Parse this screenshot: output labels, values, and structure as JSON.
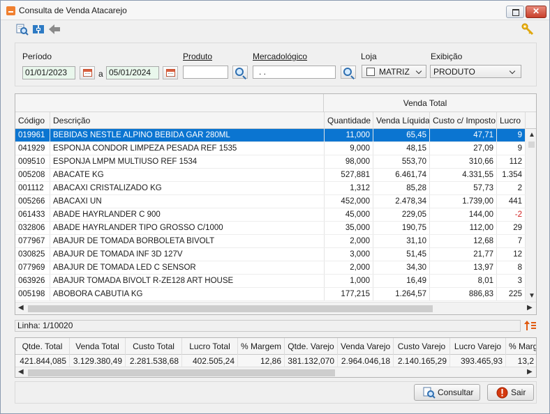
{
  "window": {
    "title": "Consulta de Venda Atacarejo",
    "close_glyph": "✕"
  },
  "toolbar": {
    "icons": [
      "search-icon",
      "export-icon",
      "back-arrow-icon",
      "key-icon"
    ]
  },
  "filters": {
    "periodo_label": "Período",
    "date_start": "01/01/2023",
    "date_sep": "a",
    "date_end": "05/01/2024",
    "produto_label": "Produto",
    "produto_value": "",
    "mercadologico_label": "Mercadológico",
    "mercadologico_value": ". .",
    "loja_label": "Loja",
    "loja_value": "MATRIZ",
    "exibicao_label": "Exibição",
    "exibicao_value": "PRODUTO"
  },
  "grid": {
    "group_header": "Venda Total",
    "columns": [
      "Código",
      "Descrição",
      "Quantidade",
      "Venda Líquida",
      "Custo c/ Imposto",
      "Lucro"
    ],
    "rows": [
      [
        "019961",
        "BEBIDAS NESTLE ALPINO BEBIDA GAR 280ML",
        "11,000",
        "65,45",
        "47,71",
        "9"
      ],
      [
        "041929",
        "ESPONJA CONDOR LIMPEZA PESADA REF 1535",
        "9,000",
        "48,15",
        "27,09",
        "9"
      ],
      [
        "009510",
        "ESPONJA LMPM MULTIUSO REF 1534",
        "98,000",
        "553,70",
        "310,66",
        "112"
      ],
      [
        "005208",
        "ABACATE KG",
        "527,881",
        "6.461,74",
        "4.331,55",
        "1.354"
      ],
      [
        "001112",
        "ABACAXI CRISTALIZADO KG",
        "1,312",
        "85,28",
        "57,73",
        "2"
      ],
      [
        "005266",
        "ABACAXI UN",
        "452,000",
        "2.478,34",
        "1.739,00",
        "441"
      ],
      [
        "061433",
        "ABADE HAYRLANDER C 900",
        "45,000",
        "229,05",
        "144,00",
        "-2"
      ],
      [
        "032806",
        "ABADE HAYRLANDER TIPO GROSSO C/1000",
        "35,000",
        "190,75",
        "112,00",
        "29"
      ],
      [
        "077967",
        "ABAJUR DE TOMADA BORBOLETA BIVOLT",
        "2,000",
        "31,10",
        "12,68",
        "7"
      ],
      [
        "030825",
        "ABAJUR DE TOMADA INF 3D 127V",
        "3,000",
        "51,45",
        "21,77",
        "12"
      ],
      [
        "077969",
        "ABAJUR DE TOMADA LED C SENSOR",
        "2,000",
        "34,30",
        "13,97",
        "8"
      ],
      [
        "063926",
        "ABAJUR TOMADA BIVOLT R-ZE128 ART HOUSE",
        "1,000",
        "16,49",
        "8,01",
        "3"
      ],
      [
        "005198",
        "ABOBORA CABUTIA KG",
        "177,215",
        "1.264,57",
        "886,83",
        "225"
      ]
    ]
  },
  "status": {
    "linha": "Linha: 1/10020"
  },
  "totals": {
    "columns": [
      "Qtde. Total",
      "Venda Total",
      "Custo Total",
      "Lucro Total",
      "% Margem",
      "Qtde. Varejo",
      "Venda Varejo",
      "Custo Varejo",
      "Lucro Varejo",
      "% Margem"
    ],
    "values": [
      "421.844,085",
      "3.129.380,49",
      "2.281.538,68",
      "402.505,24",
      "12,86",
      "381.132,070",
      "2.964.046,18",
      "2.140.165,29",
      "393.465,93",
      "13,2"
    ]
  },
  "buttons": {
    "consultar": "Consultar",
    "sair": "Sair"
  },
  "colors": {
    "selection": "#0b75d1",
    "negative": "#d02020"
  }
}
